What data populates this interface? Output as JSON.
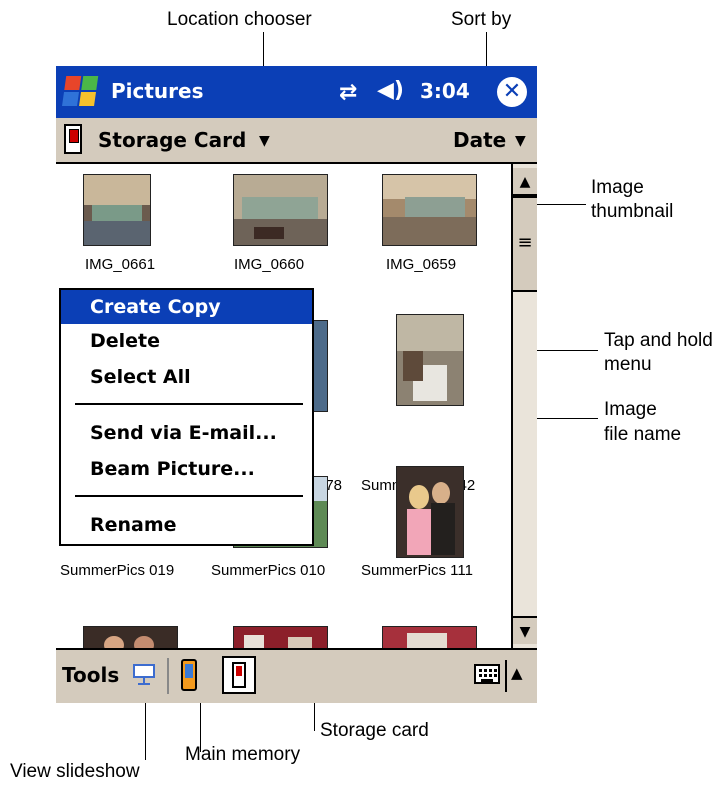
{
  "annotations": {
    "location_chooser": "Location chooser",
    "sort_by": "Sort by",
    "image_thumbnail": [
      "Image",
      "thumbnail"
    ],
    "tap_hold_menu": [
      "Tap and hold",
      "menu"
    ],
    "image_file_name": [
      "Image",
      "file name"
    ],
    "storage_card": "Storage card",
    "main_memory": "Main memory",
    "view_slideshow": "View slideshow"
  },
  "titlebar": {
    "title": "Pictures",
    "connectivity_icon": "connectivity-icon",
    "volume_icon": "volume-icon",
    "time": "3:04",
    "close_icon": "close-icon",
    "accent": "#0b3fb6"
  },
  "toolbar": {
    "location": "Storage Card",
    "sort": "Date"
  },
  "thumbnails": [
    {
      "label": "IMG_0661"
    },
    {
      "label": "IMG_0660"
    },
    {
      "label": "IMG_0659"
    },
    {
      "label": "078"
    },
    {
      "label": "SummerPics 042"
    },
    {
      "label": "SummerPics 019"
    },
    {
      "label": "SummerPics 010"
    },
    {
      "label": "SummerPics 111"
    }
  ],
  "context_menu": {
    "items": [
      "Create Copy",
      "Delete",
      "Select All",
      "Send via E-mail...",
      "Beam Picture...",
      "Rename"
    ]
  },
  "bottombar": {
    "tools": "Tools"
  }
}
